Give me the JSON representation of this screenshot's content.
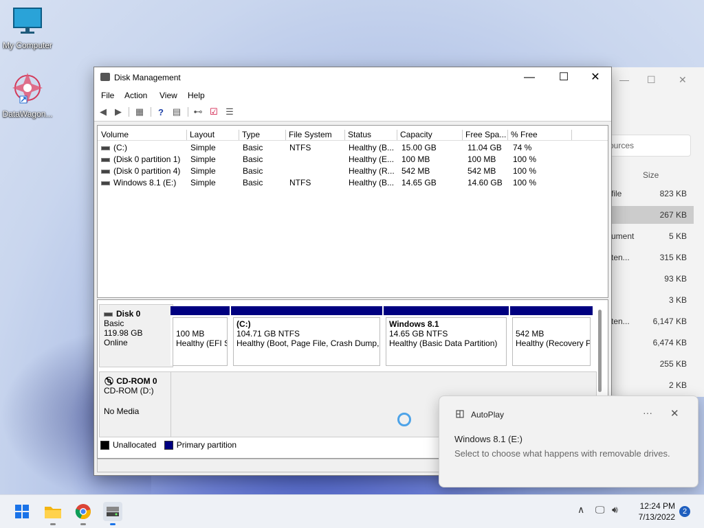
{
  "desktop": {
    "icons": [
      {
        "label": "My Computer"
      },
      {
        "label": "DataWagon..."
      }
    ]
  },
  "background_window": {
    "search_text": "ources",
    "size_header": "Size",
    "rows": [
      {
        "name": "file",
        "size": "823 KB"
      },
      {
        "name": "",
        "size": "267 KB"
      },
      {
        "name": "ument",
        "size": "5 KB"
      },
      {
        "name": "ten...",
        "size": "315 KB"
      },
      {
        "name": "",
        "size": "93 KB"
      },
      {
        "name": "",
        "size": "3 KB"
      },
      {
        "name": "ten...",
        "size": "6,147 KB"
      },
      {
        "name": "",
        "size": "6,474 KB"
      },
      {
        "name": "",
        "size": "255 KB"
      },
      {
        "name": "",
        "size": "2 KB"
      }
    ]
  },
  "window": {
    "title": "Disk Management",
    "menu": [
      "File",
      "Action",
      "View",
      "Help"
    ],
    "columns": [
      "Volume",
      "Layout",
      "Type",
      "File System",
      "Status",
      "Capacity",
      "Free Spa...",
      "% Free"
    ],
    "volumes": [
      {
        "volume": "(C:)",
        "layout": "Simple",
        "type": "Basic",
        "fs": "NTFS",
        "status": "Healthy (B...",
        "capacity": "15.00 GB",
        "free": "11.04 GB",
        "pct": "74 %"
      },
      {
        "volume": "(Disk 0 partition 1)",
        "layout": "Simple",
        "type": "Basic",
        "fs": "",
        "status": "Healthy (E...",
        "capacity": "100 MB",
        "free": "100 MB",
        "pct": "100 %"
      },
      {
        "volume": "(Disk 0 partition 4)",
        "layout": "Simple",
        "type": "Basic",
        "fs": "",
        "status": "Healthy (R...",
        "capacity": "542 MB",
        "free": "542 MB",
        "pct": "100 %"
      },
      {
        "volume": "Windows 8.1 (E:)",
        "layout": "Simple",
        "type": "Basic",
        "fs": "NTFS",
        "status": "Healthy (B...",
        "capacity": "14.65 GB",
        "free": "14.60 GB",
        "pct": "100 %"
      }
    ],
    "disk0": {
      "name": "Disk 0",
      "type": "Basic",
      "size": "119.98 GB",
      "state": "Online",
      "partitions": [
        {
          "title": "",
          "line1": "100 MB",
          "line2": "Healthy (EFI S"
        },
        {
          "title": "(C:)",
          "line1": "104.71 GB NTFS",
          "line2": "Healthy (Boot, Page File, Crash Dump, I"
        },
        {
          "title": "Windows 8.1",
          "line1": "14.65 GB NTFS",
          "line2": "Healthy (Basic Data Partition)"
        },
        {
          "title": "",
          "line1": "542 MB",
          "line2": "Healthy (Recovery P"
        }
      ]
    },
    "cdrom": {
      "name": "CD-ROM 0",
      "drive": "CD-ROM (D:)",
      "media": "No Media"
    },
    "legend": [
      "Unallocated",
      "Primary partition"
    ],
    "colors": {
      "primary_partition": "#000080",
      "unallocated": "#000000"
    }
  },
  "toast": {
    "app": "AutoPlay",
    "heading": "Windows 8.1 (E:)",
    "body": "Select to choose what happens with removable drives."
  },
  "taskbar": {
    "time": "12:24 PM",
    "date": "7/13/2022",
    "notification_count": "2"
  }
}
